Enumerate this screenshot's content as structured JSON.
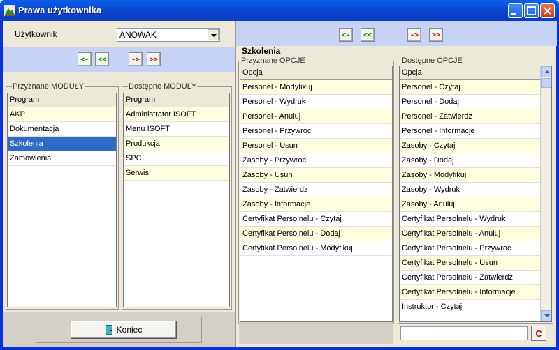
{
  "window": {
    "title": "Prawa użytkownika"
  },
  "user": {
    "label": "Użytkownik",
    "value": "ANOWAK"
  },
  "arrows": {
    "left": "<-",
    "left_all": "<<",
    "right": "->",
    "right_all": ">>"
  },
  "modules": {
    "assigned": {
      "title": "Przyznane MODUŁY",
      "header": "Program",
      "rows": [
        "AKP",
        "Dokumentacja",
        "Szkolenia",
        "Zamówienia"
      ],
      "selected_index": 2
    },
    "available": {
      "title": "Dostępne MODUŁY",
      "header": "Program",
      "rows": [
        "Administrator ISOFT",
        "Menu ISOFT",
        "Produkcja",
        "SPC",
        "Serwis"
      ]
    }
  },
  "options": {
    "section_title": "Szkolenia",
    "assigned": {
      "title": "Przyznane OPCJE",
      "header": "Opcja",
      "rows": [
        "Personel - Modyfikuj",
        "Personel - Wydruk",
        "Personel - Anuluj",
        "Personel - Przywroc",
        "Personel - Usun",
        "Zasoby - Przywroc",
        "Zasoby - Usun",
        "Zasoby - Zatwierdz",
        "Zasoby - Informacje",
        "Certyfikat Persolnelu - Czytaj",
        "Certyfikat Persolnelu - Dodaj",
        "Certyfikat Persolnelu - Modyfikuj"
      ]
    },
    "available": {
      "title": "Dostępne OPCJE",
      "header": "Opcja",
      "rows": [
        "Personel - Czytaj",
        "Personel - Dodaj",
        "Personel - Zatwierdz",
        "Personel - Informacje",
        "Zasoby - Czytaj",
        "Zasoby - Dodaj",
        "Zasoby - Modyfikuj",
        "Zasoby - Wydruk",
        "Zasoby - Anuluj",
        "Certyfikat Persolnelu - Wydruk",
        "Certyfikat Persolnelu - Anuluj",
        "Certyfikat Persolnelu - Przywroc",
        "Certyfikat Persolnelu - Usun",
        "Certyfikat Persolnelu - Zatwierdz",
        "Certyfikat Persolnelu - Informacje",
        "Instruktor - Czytaj"
      ]
    }
  },
  "footer": {
    "close_label": "Koniec",
    "search_value": "",
    "clear_label": "C"
  },
  "colors": {
    "title_blue": "#0846d0",
    "selected": "#316ac5",
    "alt_row": "#ffffe0",
    "toolbar_blue": "#c6d3f7"
  }
}
